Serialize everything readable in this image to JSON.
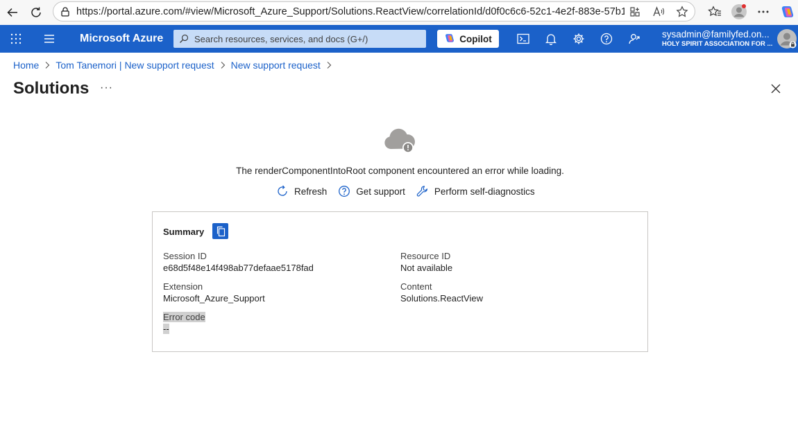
{
  "browser": {
    "url": "https://portal.azure.com/#view/Microsoft_Azure_Support/Solutions.ReactView/correlationId/d0f0c6c6-52c1-4e2f-883e-57b145..."
  },
  "header": {
    "brand": "Microsoft Azure",
    "search_placeholder": "Search resources, services, and docs (G+/)",
    "copilot_label": "Copilot",
    "account_user": "sysadmin@familyfed.on...",
    "account_tenant": "HOLY SPIRIT ASSOCIATION FOR ...",
    "brand_color": "#1b61c9"
  },
  "breadcrumb": {
    "items": [
      "Home",
      "Tom Tanemori | New support request",
      "New support request"
    ]
  },
  "page": {
    "title": "Solutions",
    "more": "···"
  },
  "error": {
    "message": "The renderComponentIntoRoot component encountered an error while loading.",
    "actions": [
      "Refresh",
      "Get support",
      "Perform self-diagnostics"
    ]
  },
  "summary": {
    "title": "Summary",
    "session_id_label": "Session ID",
    "session_id_value": "e68d5f48e14f498ab77defaae5178fad",
    "resource_id_label": "Resource ID",
    "resource_id_value": "Not available",
    "extension_label": "Extension",
    "extension_value": "Microsoft_Azure_Support",
    "content_label": "Content",
    "content_value": "Solutions.ReactView",
    "error_code_label": "Error code",
    "error_code_value": "--"
  }
}
